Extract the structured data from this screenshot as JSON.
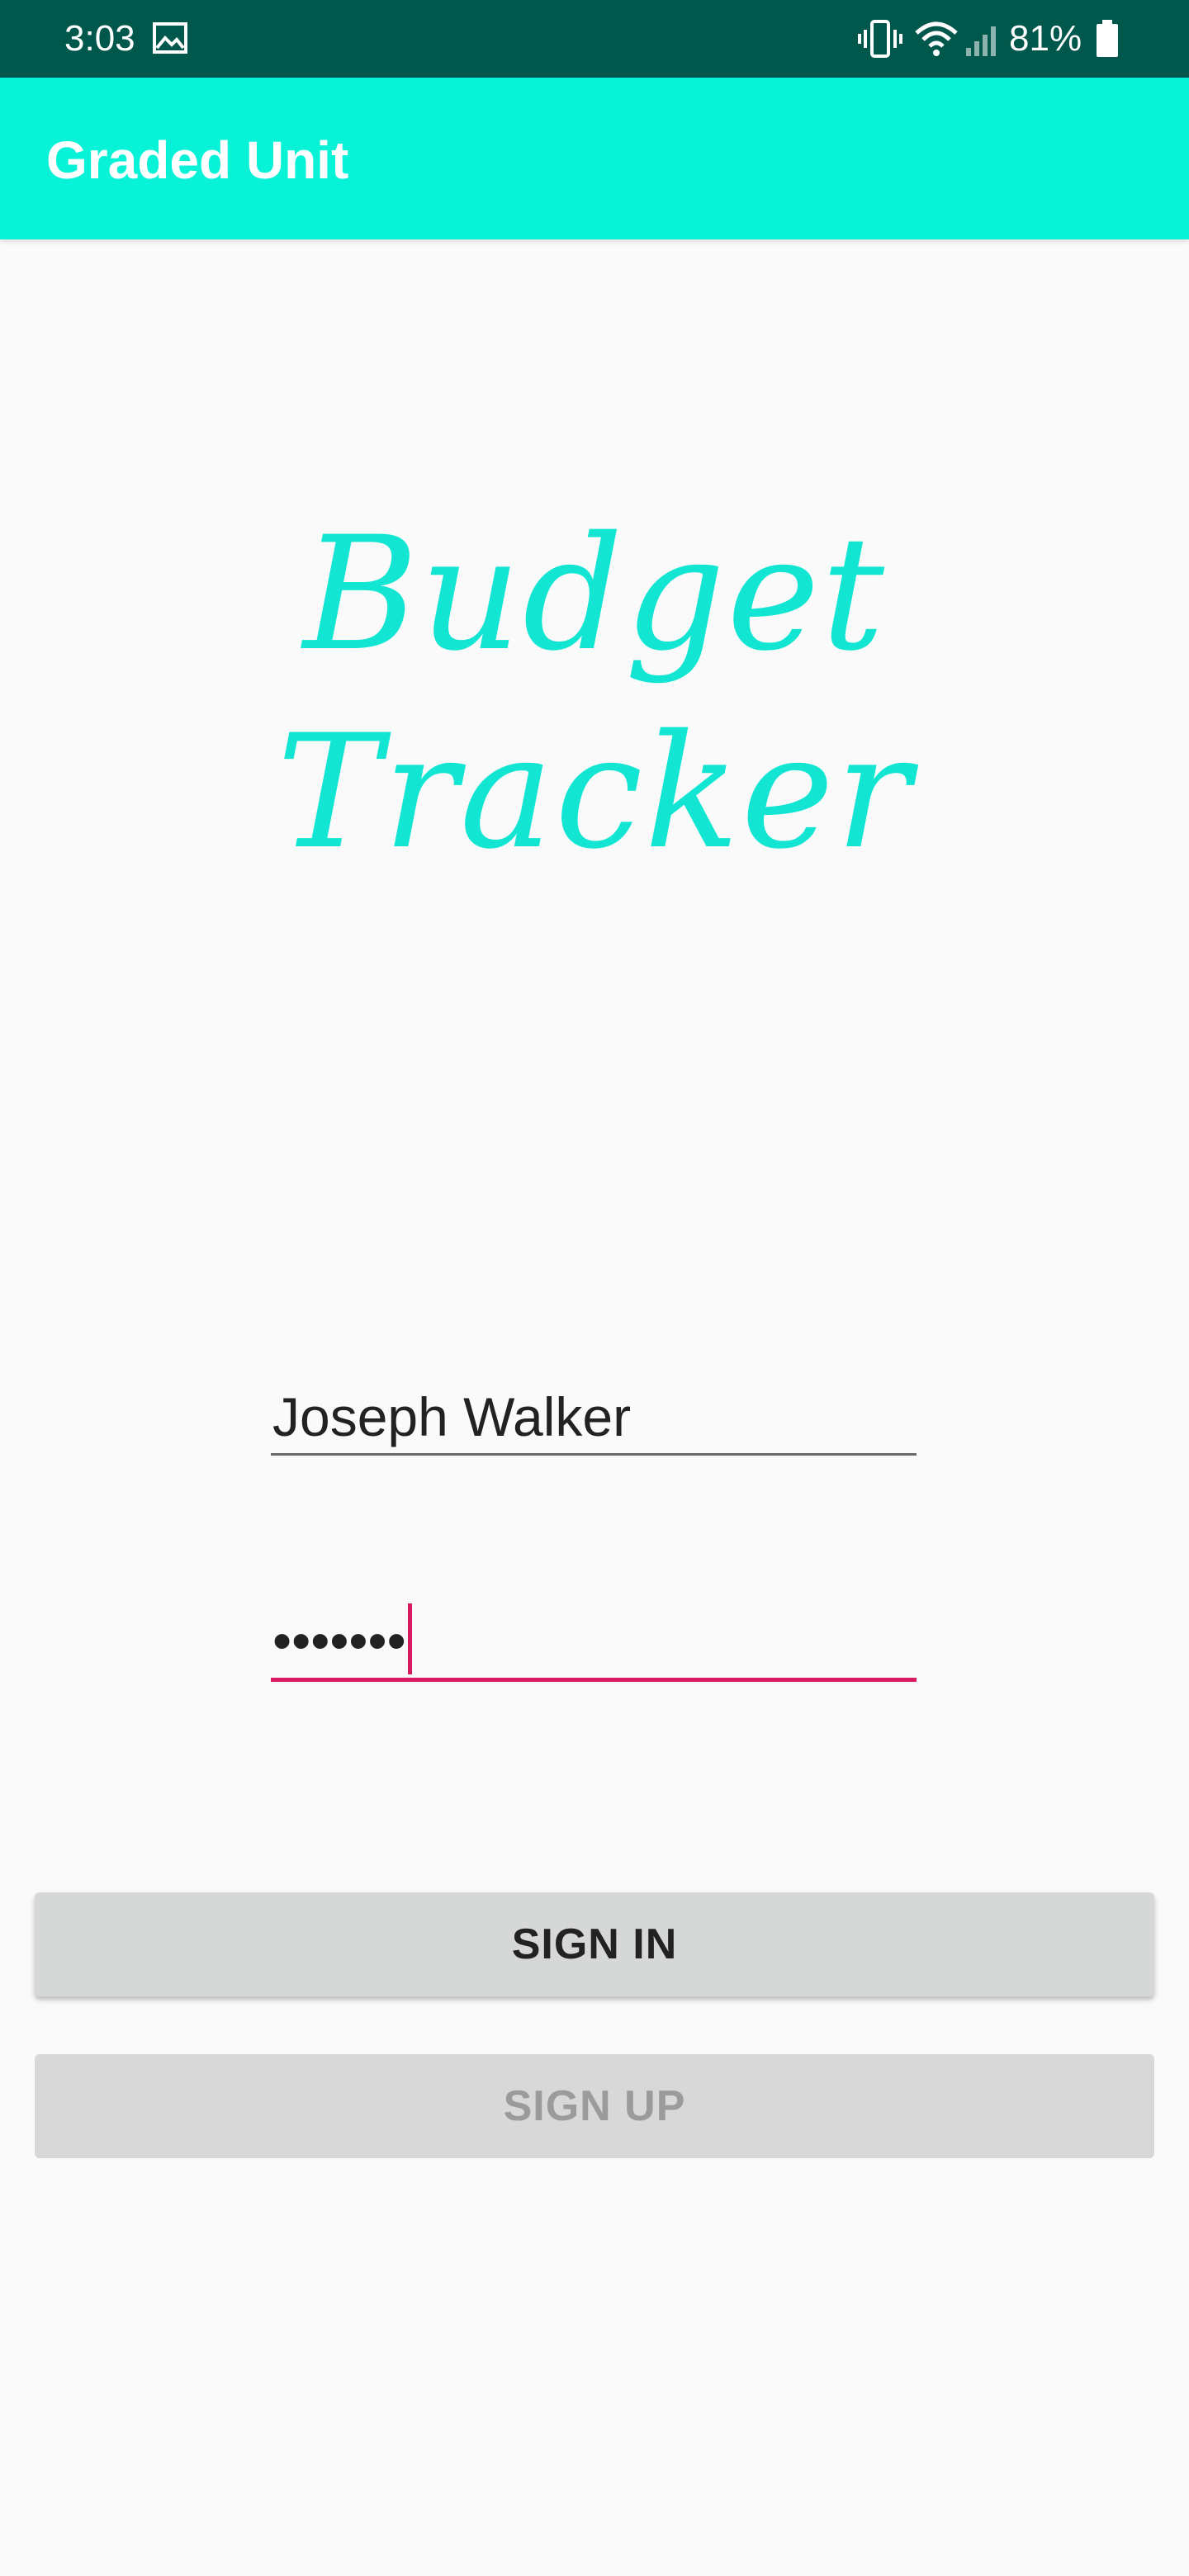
{
  "status_bar": {
    "time": "3:03",
    "battery": "81%",
    "icons": [
      "image-icon",
      "vibrate-icon",
      "wifi-icon",
      "signal-icon",
      "battery-icon"
    ]
  },
  "app_bar": {
    "title": "Graded Unit",
    "color": "#07f2d7"
  },
  "logo": {
    "text": "Budget Tracker",
    "color": "#12e6d3"
  },
  "form": {
    "username_value": "Joseph Walker",
    "password_masked": "•••••••"
  },
  "buttons": {
    "sign_in": "SIGN IN",
    "sign_up": "SIGN UP"
  },
  "colors": {
    "status_bar": "#00574b",
    "accent": "#d81b60",
    "button_bg": "#d6d7d7"
  }
}
